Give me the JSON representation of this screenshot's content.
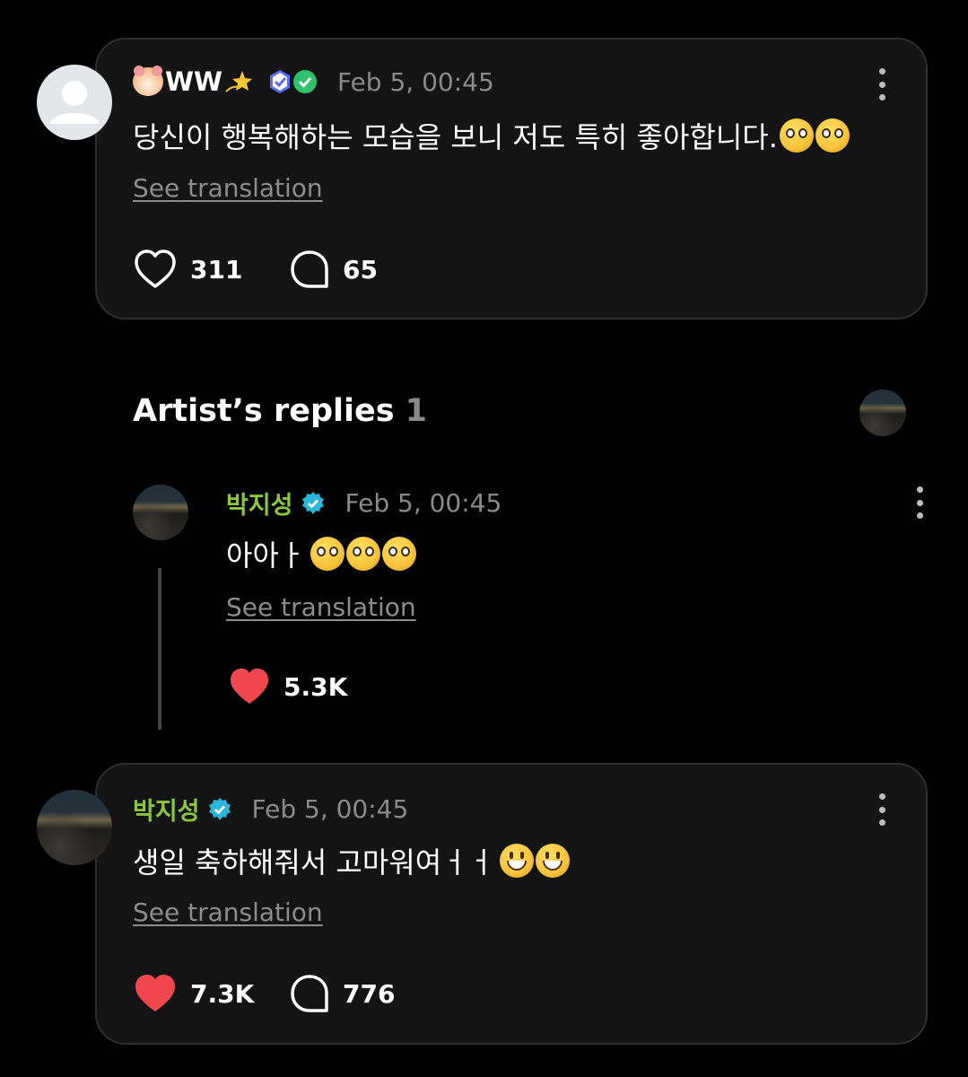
{
  "comment": {
    "username": "WW",
    "date": "Feb 5, 00:45",
    "text": "당신이 행복해하는 모습을 보니 저도 특히 좋아합니다.",
    "see_translation": "See translation",
    "likes": "311",
    "replies": "65"
  },
  "artist_replies": {
    "title": "Artist’s replies",
    "count": "1",
    "reply": {
      "name": "박지성",
      "date": "Feb 5, 00:45",
      "text": "아아ㅏ",
      "see_translation": "See translation",
      "likes": "5.3K"
    }
  },
  "artist_post": {
    "name": "박지성",
    "date": "Feb 5, 00:45",
    "text": "생일 축하해줘서 고마워여ㅓㅓ",
    "see_translation": "See translation",
    "likes": "7.3K",
    "replies": "776"
  },
  "colors": {
    "artist_name": "#8cc63f",
    "liked_heart": "#f0474f",
    "verified_badge": "#29b6d9",
    "card_bg": "#141414"
  },
  "icons": [
    "more-vertical-icon",
    "heart-outline-icon",
    "heart-filled-icon",
    "comment-bubble-icon",
    "verified-badge-icon",
    "user-default-icon"
  ]
}
